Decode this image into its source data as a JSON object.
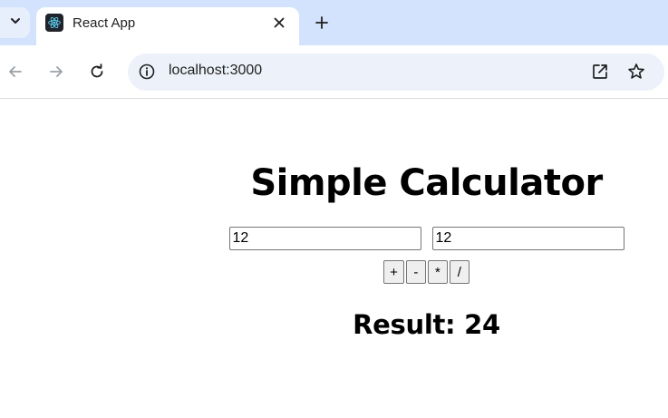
{
  "browser": {
    "tab": {
      "title": "React App",
      "favicon": "react-logo-icon"
    },
    "address_bar": {
      "url": "localhost:3000"
    },
    "icons": {
      "tab_search": "chevron-down-icon",
      "close_tab": "close-icon",
      "new_tab": "plus-icon",
      "back": "arrow-left-icon",
      "forward": "arrow-right-icon",
      "reload": "reload-icon",
      "site_info": "info-icon",
      "open_in_app": "open-external-icon",
      "bookmark": "star-icon"
    }
  },
  "calculator": {
    "title": "Simple Calculator",
    "inputs": {
      "first_value": "12",
      "second_value": "12"
    },
    "operations": [
      {
        "label": "+"
      },
      {
        "label": "-"
      },
      {
        "label": "*"
      },
      {
        "label": "/"
      }
    ],
    "result_text": "Result: 24"
  }
}
